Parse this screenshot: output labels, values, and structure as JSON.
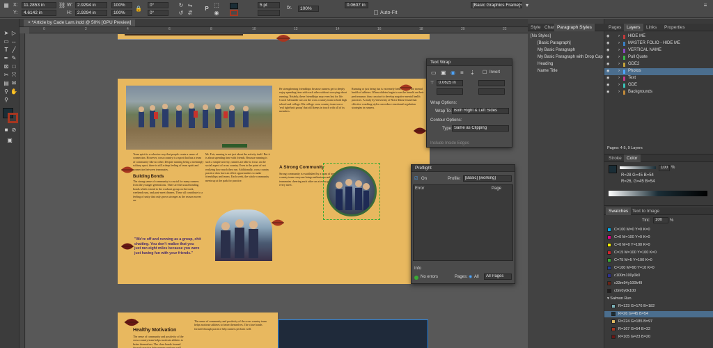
{
  "control_bar": {
    "x_label": "X:",
    "x_value": "11.2853 in",
    "y_label": "Y:",
    "y_value": "4.6142 in",
    "w_label": "W:",
    "w_value": "2.9294 in",
    "h_label": "H:",
    "h_value": "2.9294 in",
    "scale_x": "100%",
    "scale_y": "100%",
    "rotate": "0°",
    "shear": "0°",
    "stroke_weight": "5 pt",
    "opacity": "100%",
    "offset": "0.0607 in",
    "fx_label": "fx.",
    "autofit_label": "Auto-Fit",
    "frame_style": "[Basic Graphics Frame]+"
  },
  "document": {
    "tab_title": "*Article by Cade Lam.indd @ 50% [GPU Preview]"
  },
  "ruler": {
    "ticks": [
      "0",
      "2",
      "4",
      "6",
      "8",
      "10",
      "12",
      "14",
      "16",
      "18",
      "20",
      "22"
    ]
  },
  "tools": [
    "selection",
    "direct-selection",
    "page",
    "gap",
    "type",
    "line",
    "pen",
    "pencil",
    "rectangle-frame",
    "rectangle",
    "scissors",
    "free-transform",
    "gradient",
    "note",
    "eyedropper",
    "hand",
    "zoom"
  ],
  "article": {
    "left_caption": "Team spirit is a cohesive way that people create a sense of connection. However, cross country is a sport that has a team of community like no other. Despite running being a seemingly solitary sport, there is still a deep feeling of team spirit and connection between teammates.",
    "heading_building_bonds": "Building Bonds",
    "building_text": "The strong sense of community is crucial for many runners from the younger generations. There are the usual bonding, bonds which extend to the workout group on the track, weekend runs, and post-meet dinners. These all contribute to a feeling of unity that only grows stronger as the season moves on.",
    "quote": "\"We're off and running as a group, chit chatting. You don't realize that you just ran eight miles because you were just having fun with your friends.\"",
    "col2_text": "Mr. Fair, running is not just about the activity itself. But it is about spending time with friends. Because running is such a simple activity, runners are able to focus on the social aspect of cross country. Even to the point of not realizing how much they run. Additionally, cross country practice does have an effect opportunities to make friendships and teams. Each week, the whole community meets up at the park for practice.",
    "col3_text": "Be strengthening friendships because runners get to deeply enjoy spending time with each other without worrying about running. Notably, these friendships may even last for life. Coach Alexander was on the cross country team in both high school and college. His college cross country team was a 'real tight-knit group' that still keeps in touch with all of its members.",
    "heading_strong_community": "A Strong Community",
    "col3_text_b": "Strong community is established by a team of people. Cross country team everyone brings enthusiasm and support, with teammates cheering each other on at every practice and every meet.",
    "col4_text": "Running or just being fun is extremely beneficial for the mental health of athletes. When athletes begin to see the benefit on their performance, they can start to develop negative mental health practices. A study by University of Notre Dame found that effective coaching styles can reduce emotional regulation strategies in runners.",
    "heading_healthy": "Healthy Motivation",
    "bottom_text": "The sense of community and positivity of the cross country team helps motivate athletes to better themselves. The close bonds formed through practice help runners perform well."
  },
  "text_wrap_panel": {
    "title": "Text Wrap",
    "invert_label": "Invert",
    "offset_value": "0.0625 in",
    "wrap_options_label": "Wrap Options:",
    "wrap_to_label": "Wrap To:",
    "wrap_to_value": "Both Right & Left Sides",
    "contour_options_label": "Contour Options:",
    "type_label": "Type:",
    "type_value": "Same as Clipping",
    "include_inside_edges": "Include Inside Edges"
  },
  "preflight_panel": {
    "title": "Preflight",
    "on_label": "On",
    "profile_label": "Profile:",
    "profile_value": "[Basic] (working)",
    "col_error": "Error",
    "col_page": "Page",
    "info_label": "Info",
    "status_label": "No errors",
    "pages_label": "Pages:",
    "pages_all": "All",
    "pages_value": "All Pages"
  },
  "paragraph_styles": {
    "tabs": [
      "Style",
      "Char",
      "Paragraph Styles"
    ],
    "items": [
      "[No Styles]",
      "[Basic Paragraph]",
      "My Basic Paragraph",
      "My Basic Paragraph with Drop Cap",
      "Heading",
      "Name Title"
    ]
  },
  "layers": {
    "tabs": [
      "Pages",
      "Layers",
      "Links",
      "Properties"
    ],
    "items": [
      "HIDE ME",
      "MASTER FOLIO - HIDE ME",
      "VERTICAL NAME",
      "Pull Quote",
      "GDE2",
      "Photos",
      "Text",
      "GDE",
      "Backgrounds"
    ],
    "selected_index": 5,
    "footer": "Pages: 4-5, 9 Layers"
  },
  "color_panel": {
    "tabs": [
      "Stroke",
      "Color"
    ],
    "tint_value": "100",
    "tint_unit": "%",
    "color_a": "R=28 G=45 B=54",
    "color_b": "R=26, G=45 B=54"
  },
  "swatches": {
    "tabs": [
      "Swatches",
      "Text to Image"
    ],
    "tint_label": "Tint:",
    "tint_value": "100",
    "tint_unit": "%",
    "items": [
      {
        "name": "C=100 M=0 Y=0 K=0",
        "color": "#00aeef"
      },
      {
        "name": "C=0 M=100 Y=0 K=0",
        "color": "#ec008c"
      },
      {
        "name": "C=0 M=0 Y=100 K=0",
        "color": "#fff200"
      },
      {
        "name": "C=15 M=100 Y=100 K=0",
        "color": "#d2232a"
      },
      {
        "name": "C=75 M=5 Y=100 K=0",
        "color": "#3aaa35"
      },
      {
        "name": "C=100 M=90 Y=10 K=0",
        "color": "#21409a"
      },
      {
        "name": "c100m100y0k0",
        "color": "#2e3192"
      },
      {
        "name": "c33m94y100k49",
        "color": "#6b2214"
      },
      {
        "name": "c0m0y0k100",
        "color": "#231f20"
      }
    ],
    "group_label": "Salmon Run",
    "group_items": [
      {
        "name": "R=123 G=176 B=182",
        "color": "#7bb0b6"
      },
      {
        "name": "R=26 G=45 B=54",
        "color": "#1a2d36"
      },
      {
        "name": "R=224 G=185 B=97",
        "color": "#e0b961"
      },
      {
        "name": "R=167 G=54 B=32",
        "color": "#a73620"
      },
      {
        "name": "R=105 G=23 B=20",
        "color": "#691714"
      }
    ],
    "selected_group_index": 1
  },
  "colors": {
    "accent": "#2d8ceb",
    "selection_highlight": "#4b6e8e",
    "page_background": "#e8b85f",
    "fill_swatch": "#1a2d36",
    "stroke_swatch": "#a73620",
    "layer_photos": "#4da6ff"
  },
  "icons": [
    "lock-icon",
    "eye-icon",
    "gear-icon",
    "chevron-down-icon",
    "menu-icon"
  ]
}
